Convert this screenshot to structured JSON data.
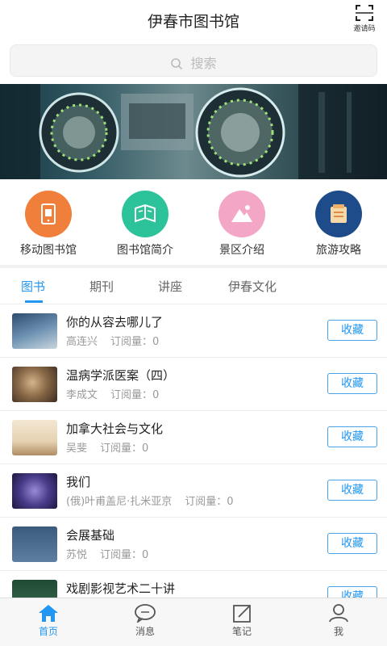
{
  "header": {
    "title": "伊春市图书馆",
    "qr_label": "邀请码"
  },
  "search": {
    "placeholder": "搜索"
  },
  "menu": [
    {
      "label": "移动图书馆",
      "color": "#f07f3c",
      "icon": "mobile-library-icon"
    },
    {
      "label": "图书馆简介",
      "color": "#2cc29a",
      "icon": "library-intro-icon"
    },
    {
      "label": "景区介绍",
      "color": "#f3a6c6",
      "icon": "scenic-icon"
    },
    {
      "label": "旅游攻略",
      "color": "#1e4c8a",
      "icon": "travel-guide-icon"
    }
  ],
  "tabs": [
    {
      "label": "图书",
      "active": true
    },
    {
      "label": "期刊",
      "active": false
    },
    {
      "label": "讲座",
      "active": false
    },
    {
      "label": "伊春文化",
      "active": false
    }
  ],
  "books": [
    {
      "title": "你的从容去哪儿了",
      "author": "高连兴",
      "subs": "订阅量：0",
      "button": "收藏"
    },
    {
      "title": "温病学派医案（四）",
      "author": "李成文",
      "subs": "订阅量：0",
      "button": "收藏"
    },
    {
      "title": "加拿大社会与文化",
      "author": "吴斐",
      "subs": "订阅量：0",
      "button": "收藏"
    },
    {
      "title": "我们",
      "author": "(俄)叶甫盖尼·扎米亚京",
      "subs": "订阅量：0",
      "button": "收藏"
    },
    {
      "title": "会展基础",
      "author": "苏悦",
      "subs": "订阅量：0",
      "button": "收藏"
    },
    {
      "title": "戏剧影视艺术二十讲",
      "author": "",
      "subs": "",
      "button": "收藏"
    }
  ],
  "nav": [
    {
      "label": "首页",
      "active": true,
      "icon": "home-icon"
    },
    {
      "label": "消息",
      "active": false,
      "icon": "message-icon"
    },
    {
      "label": "笔记",
      "active": false,
      "icon": "note-icon"
    },
    {
      "label": "我",
      "active": false,
      "icon": "user-icon"
    }
  ],
  "colors": {
    "accent": "#2196f3"
  }
}
